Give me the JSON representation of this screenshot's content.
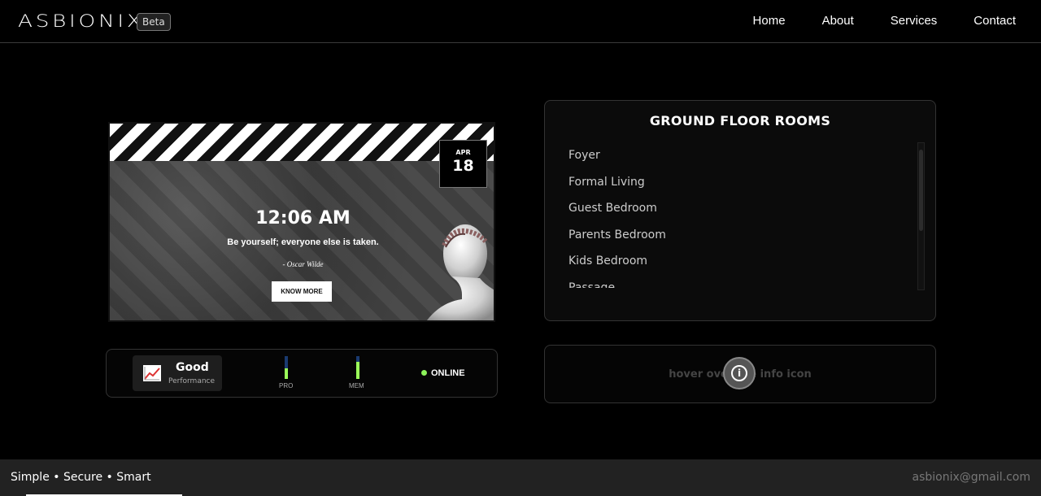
{
  "header": {
    "logo": "ASBIONIX",
    "badge": "Beta",
    "nav": [
      "Home",
      "About",
      "Services",
      "Contact"
    ]
  },
  "card": {
    "month": "APR",
    "day": "18",
    "time": "12:06 AM",
    "quote": "Be yourself; everyone else is taken.",
    "author": "- Oscar Wilde",
    "button": "KNOW MORE"
  },
  "rooms": {
    "title": "GROUND FLOOR ROOMS",
    "items": [
      "Foyer",
      "Formal Living",
      "Guest Bedroom",
      "Parents Bedroom",
      "Kids Bedroom",
      "Passage"
    ]
  },
  "status": {
    "performance": "Good",
    "performance_label": "Performance",
    "pro_label": "PRO",
    "pro_level": 0.45,
    "mem_label": "MEM",
    "mem_level": 0.75,
    "online": "ONLINE"
  },
  "info": {
    "text": "hover over the info icon",
    "icon": "info-icon"
  },
  "footer": {
    "tagline": "Simple • Secure • Smart",
    "email": "asbionix@gmail.com"
  },
  "colors": {
    "accent_green": "#9bff5a",
    "meter_track": "#1a3a70"
  }
}
